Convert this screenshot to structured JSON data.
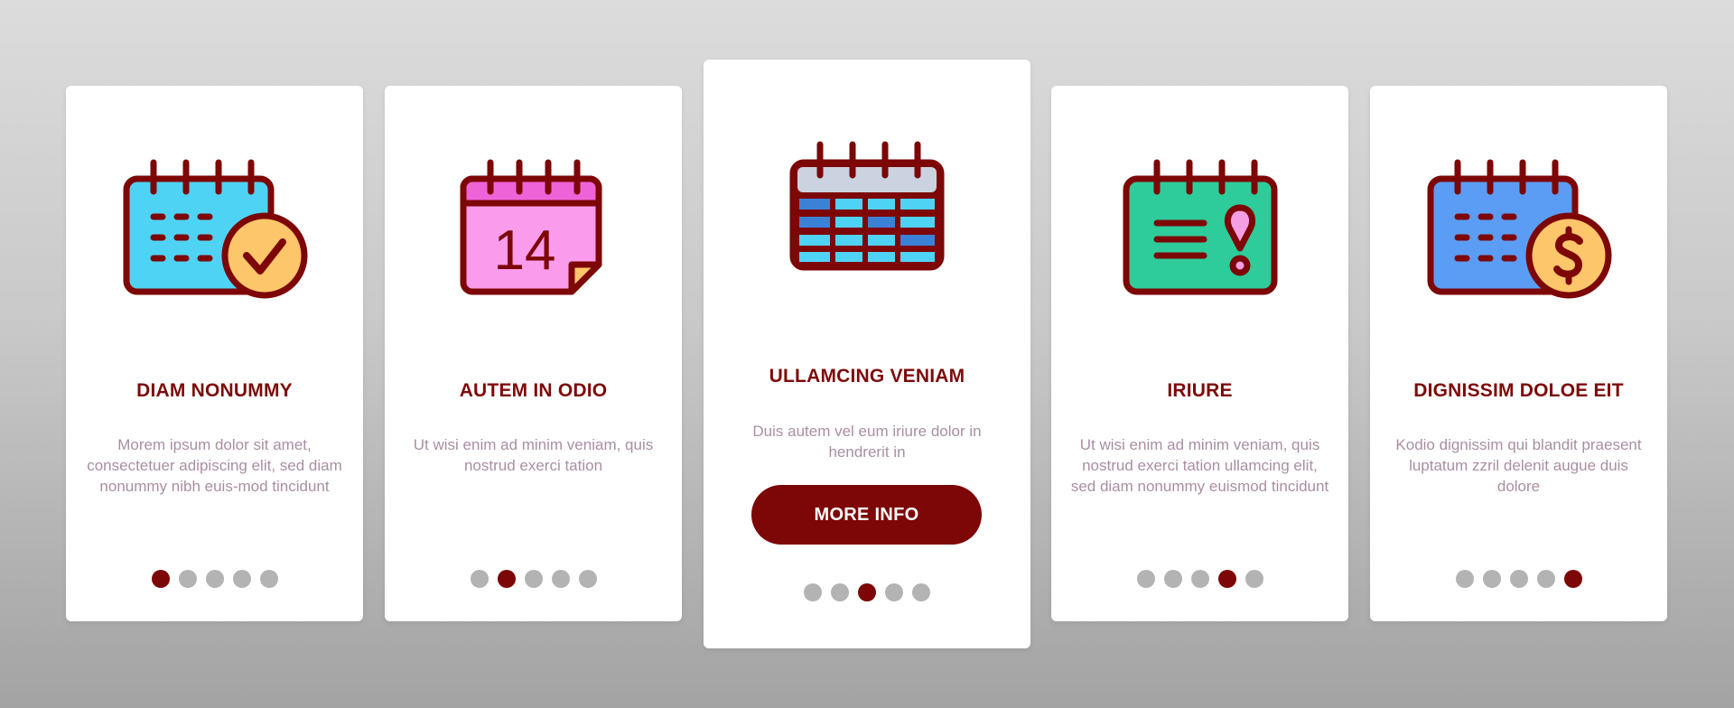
{
  "colors": {
    "accent": "#7d0606",
    "title": "#7d0a0a",
    "description": "#a98ea3",
    "dot_inactive": "#b3b3b3",
    "card_bg": "#ffffff"
  },
  "cards": [
    {
      "icon": "calendar-check-icon",
      "title": "DIAM NONUMMY",
      "description": "Morem ipsum dolor sit amet, consectetuer adipiscing elit, sed diam nonummy nibh euis-mod tincidunt",
      "active_dot": 1,
      "dot_count": 5
    },
    {
      "icon": "calendar-date-icon",
      "icon_text": "14",
      "title": "AUTEM IN ODIO",
      "description": "Ut wisi enim ad minim veniam, quis nostrud exerci tation",
      "active_dot": 2,
      "dot_count": 5
    },
    {
      "icon": "calendar-grid-icon",
      "title": "ULLAMCING VENIAM",
      "description": "Duis autem vel eum iriure dolor in hendrerit in",
      "button_label": "MORE INFO",
      "active_dot": 3,
      "dot_count": 5
    },
    {
      "icon": "calendar-alert-icon",
      "title": "IRIURE",
      "description": "Ut wisi enim ad minim veniam, quis nostrud exerci tation ullamcing elit, sed diam nonummy euismod tincidunt",
      "active_dot": 4,
      "dot_count": 5
    },
    {
      "icon": "calendar-dollar-icon",
      "title": "DIGNISSIM DOLOE EIT",
      "description": "Kodio dignissim qui blandit praesent luptatum zzril delenit augue duis dolore",
      "active_dot": 5,
      "dot_count": 5
    }
  ]
}
